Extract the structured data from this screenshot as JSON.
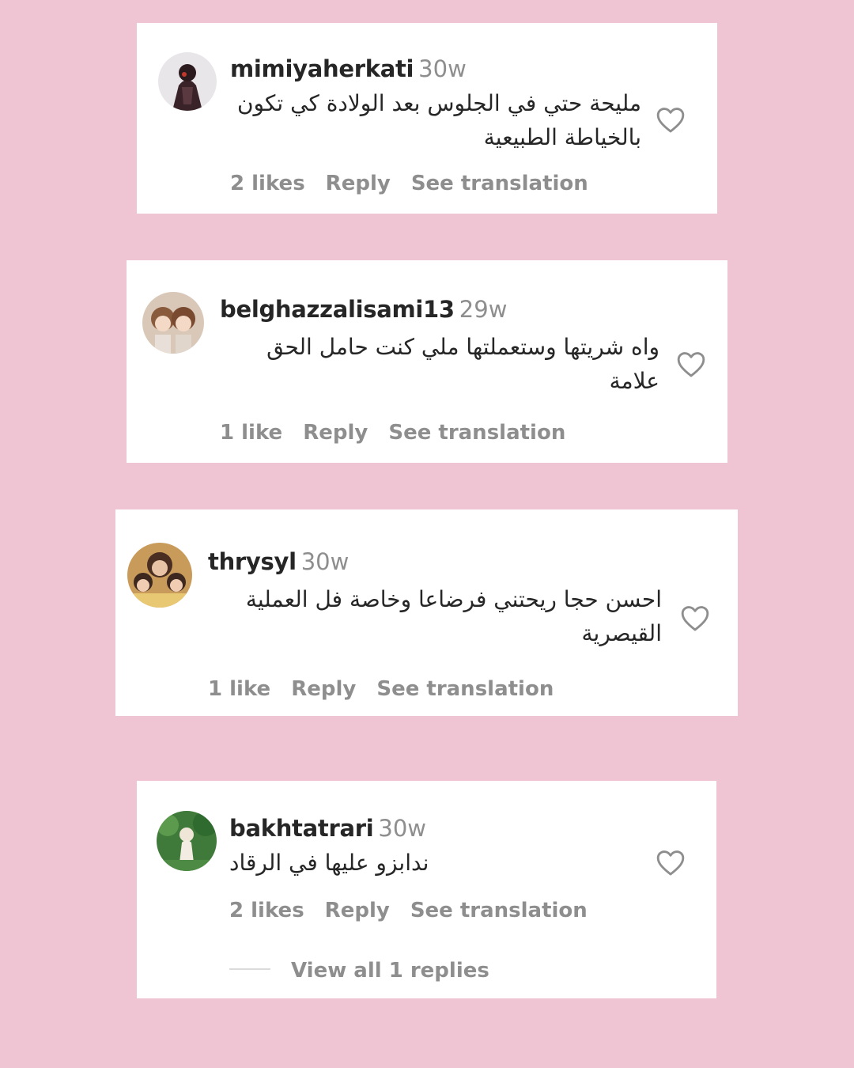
{
  "comments": [
    {
      "username": "mimiyaherkati",
      "time": "30w",
      "text": "مليحة حتي في الجلوس بعد الولادة كي تكون بالخياطة الطبيعية",
      "likes": "2 likes",
      "reply": "Reply",
      "translate": "See translation",
      "avatar_icon": "avatar-photo-dark"
    },
    {
      "username": "belghazzalisami13",
      "time": "29w",
      "text": "واه شريتها وستعملتها ملي كنت حامل الحق علامة",
      "likes": "1 like",
      "reply": "Reply",
      "translate": "See translation",
      "avatar_icon": "avatar-photo-dolls"
    },
    {
      "username": "thrysyl",
      "time": "30w",
      "text": "احسن حجا ريحتني فرضاعا وخاصة فل العملية القيصرية",
      "likes": "1 like",
      "reply": "Reply",
      "translate": "See translation",
      "avatar_icon": "avatar-photo-family"
    },
    {
      "username": "bakhtatrari",
      "time": "30w",
      "text": "ندابزو عليها في الرقاد",
      "likes": "2 likes",
      "reply": "Reply",
      "translate": "See translation",
      "view_replies": "View all 1 replies",
      "avatar_icon": "avatar-photo-outdoor"
    }
  ],
  "colors": {
    "background": "#efc5d4",
    "card": "#ffffff",
    "username": "#262626",
    "secondary": "#8e8e8e"
  },
  "icons": {
    "like": "heart-outline-icon"
  }
}
